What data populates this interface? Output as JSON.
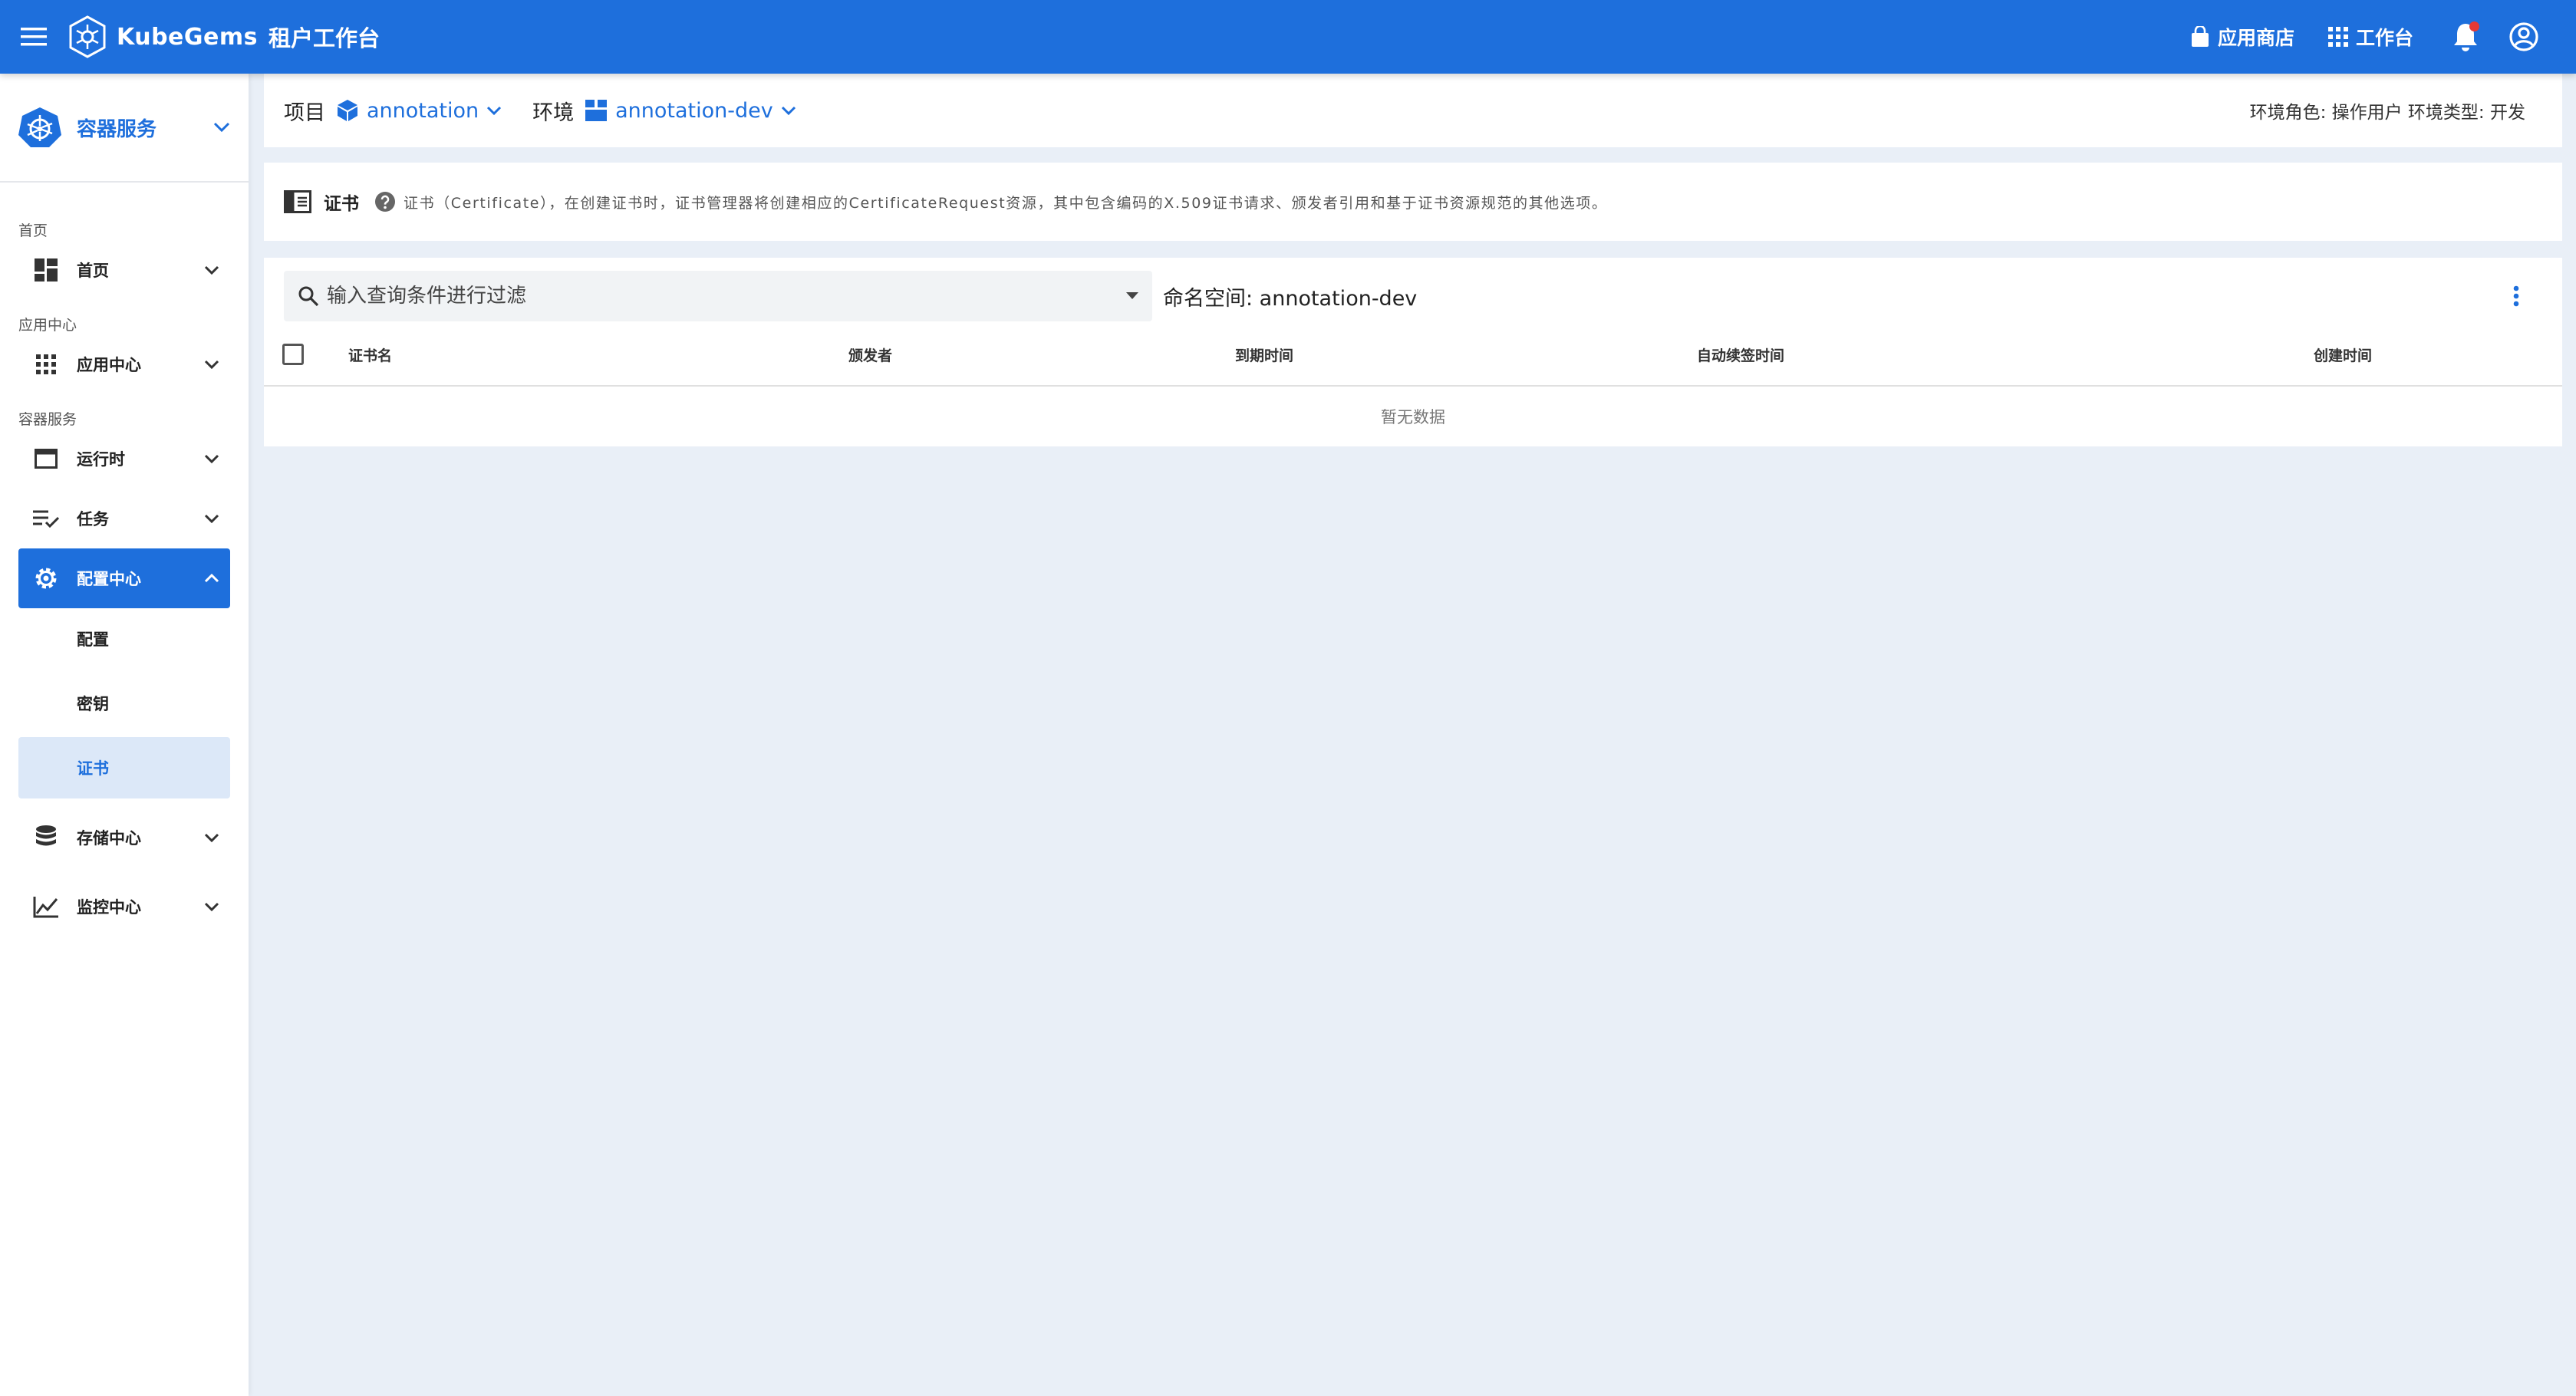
{
  "header": {
    "brand": "KubeGems",
    "subtitle": "租户工作台",
    "app_store": "应用商店",
    "workbench": "工作台"
  },
  "sidebar": {
    "switcher": "容器服务",
    "sections": [
      {
        "label": "首页",
        "items": [
          {
            "label": "首页"
          }
        ]
      },
      {
        "label": "应用中心",
        "items": [
          {
            "label": "应用中心"
          }
        ]
      },
      {
        "label": "容器服务",
        "items": [
          {
            "label": "运行时"
          },
          {
            "label": "任务"
          },
          {
            "label": "配置中心",
            "children": [
              "配置",
              "密钥",
              "证书"
            ]
          },
          {
            "label": "存储中心"
          },
          {
            "label": "监控中心"
          }
        ]
      }
    ]
  },
  "context": {
    "project_label": "项目",
    "project_value": "annotation",
    "env_label": "环境",
    "env_value": "annotation-dev",
    "role_info": "环境角色: 操作用户  环境类型: 开发"
  },
  "page": {
    "title": "证书",
    "description": "证书（Certificate），在创建证书时，证书管理器将创建相应的CertificateRequest资源，其中包含编码的X.509证书请求、颁发者引用和基于证书资源规范的其他选项。"
  },
  "table": {
    "search_placeholder": "输入查询条件进行过滤",
    "namespace": "命名空间: annotation-dev",
    "columns": [
      "证书名",
      "颁发者",
      "到期时间",
      "自动续签时间",
      "创建时间"
    ],
    "empty_text": "暂无数据"
  },
  "colors": {
    "primary": "#1e6fdc",
    "background": "#e9eff7",
    "selected": "#dce8f8"
  }
}
